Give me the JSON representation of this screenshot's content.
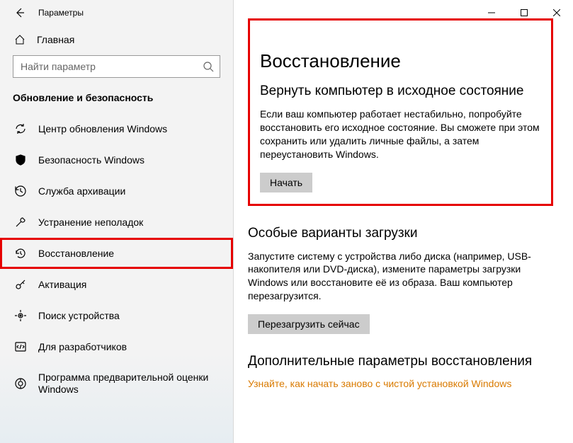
{
  "titlebar": {
    "text": "Параметры"
  },
  "home_label": "Главная",
  "search": {
    "placeholder": "Найти параметр"
  },
  "section_title": "Обновление и безопасность",
  "nav": [
    {
      "label": "Центр обновления Windows"
    },
    {
      "label": "Безопасность Windows"
    },
    {
      "label": "Служба архивации"
    },
    {
      "label": "Устранение неполадок"
    },
    {
      "label": "Восстановление"
    },
    {
      "label": "Активация"
    },
    {
      "label": "Поиск устройства"
    },
    {
      "label": "Для разработчиков"
    },
    {
      "label": "Программа предварительной оценки Windows"
    }
  ],
  "page": {
    "title": "Восстановление",
    "reset": {
      "heading": "Вернуть компьютер в исходное состояние",
      "body": "Если ваш компьютер работает нестабильно, попробуйте восстановить его исходное состояние. Вы сможете при этом сохранить или удалить личные файлы, а затем переустановить Windows.",
      "button": "Начать"
    },
    "advanced_startup": {
      "heading": "Особые варианты загрузки",
      "body": "Запустите систему с устройства либо диска (например, USB-накопителя или DVD-диска), измените параметры загрузки Windows или восстановите её из образа. Ваш компьютер перезагрузится.",
      "button": "Перезагрузить сейчас"
    },
    "more": {
      "heading": "Дополнительные параметры восстановления",
      "link": "Узнайте, как начать заново с чистой установкой Windows"
    }
  }
}
